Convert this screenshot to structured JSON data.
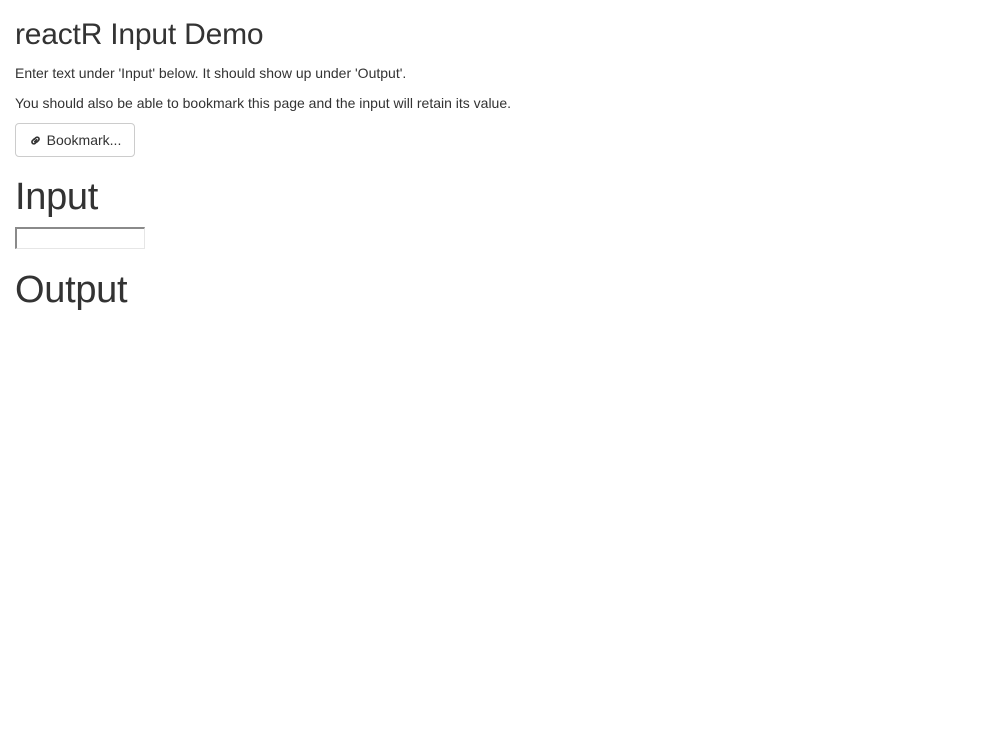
{
  "header": {
    "title": "reactR Input Demo"
  },
  "intro": {
    "line1": "Enter text under 'Input' below. It should show up under 'Output'.",
    "line2": "You should also be able to bookmark this page and the input will retain its value."
  },
  "bookmark": {
    "label": "Bookmark...",
    "icon": "link-icon"
  },
  "input_section": {
    "heading": "Input",
    "value": "",
    "placeholder": ""
  },
  "output_section": {
    "heading": "Output",
    "value": ""
  }
}
